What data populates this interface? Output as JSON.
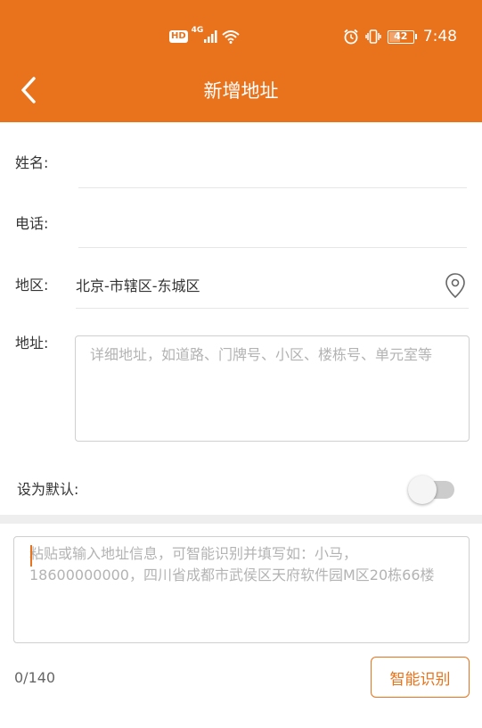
{
  "status_bar": {
    "network": "4G",
    "hd_label": "HD",
    "battery": "42",
    "time": "7:48",
    "icons": [
      "hd-icon",
      "signal-icon",
      "wifi-icon",
      "alarm-icon",
      "vibrate-icon",
      "battery-icon"
    ]
  },
  "header": {
    "title": "新增地址",
    "back_icon": "chevron-left-icon"
  },
  "form": {
    "name_label": "姓名:",
    "name_value": "",
    "phone_label": "电话:",
    "phone_value": "",
    "region_label": "地区:",
    "region_value": "北京-市辖区-东城区",
    "region_icon": "location-pin-icon",
    "address_label": "地址:",
    "address_placeholder": "详细地址，如道路、门牌号、小区、楼栋号、单元室等",
    "default_label": "设为默认:",
    "default_enabled": false
  },
  "smart_paste": {
    "placeholder": "粘贴或输入地址信息，可智能识别并填写如：小马，18600000000，四川省成都市武侯区天府软件园M区20栋66楼",
    "counter": "0/140",
    "button_label": "智能识别"
  },
  "colors": {
    "accent": "#E8731C",
    "divider": "#e6e6e6",
    "placeholder": "#b3b3b3"
  }
}
